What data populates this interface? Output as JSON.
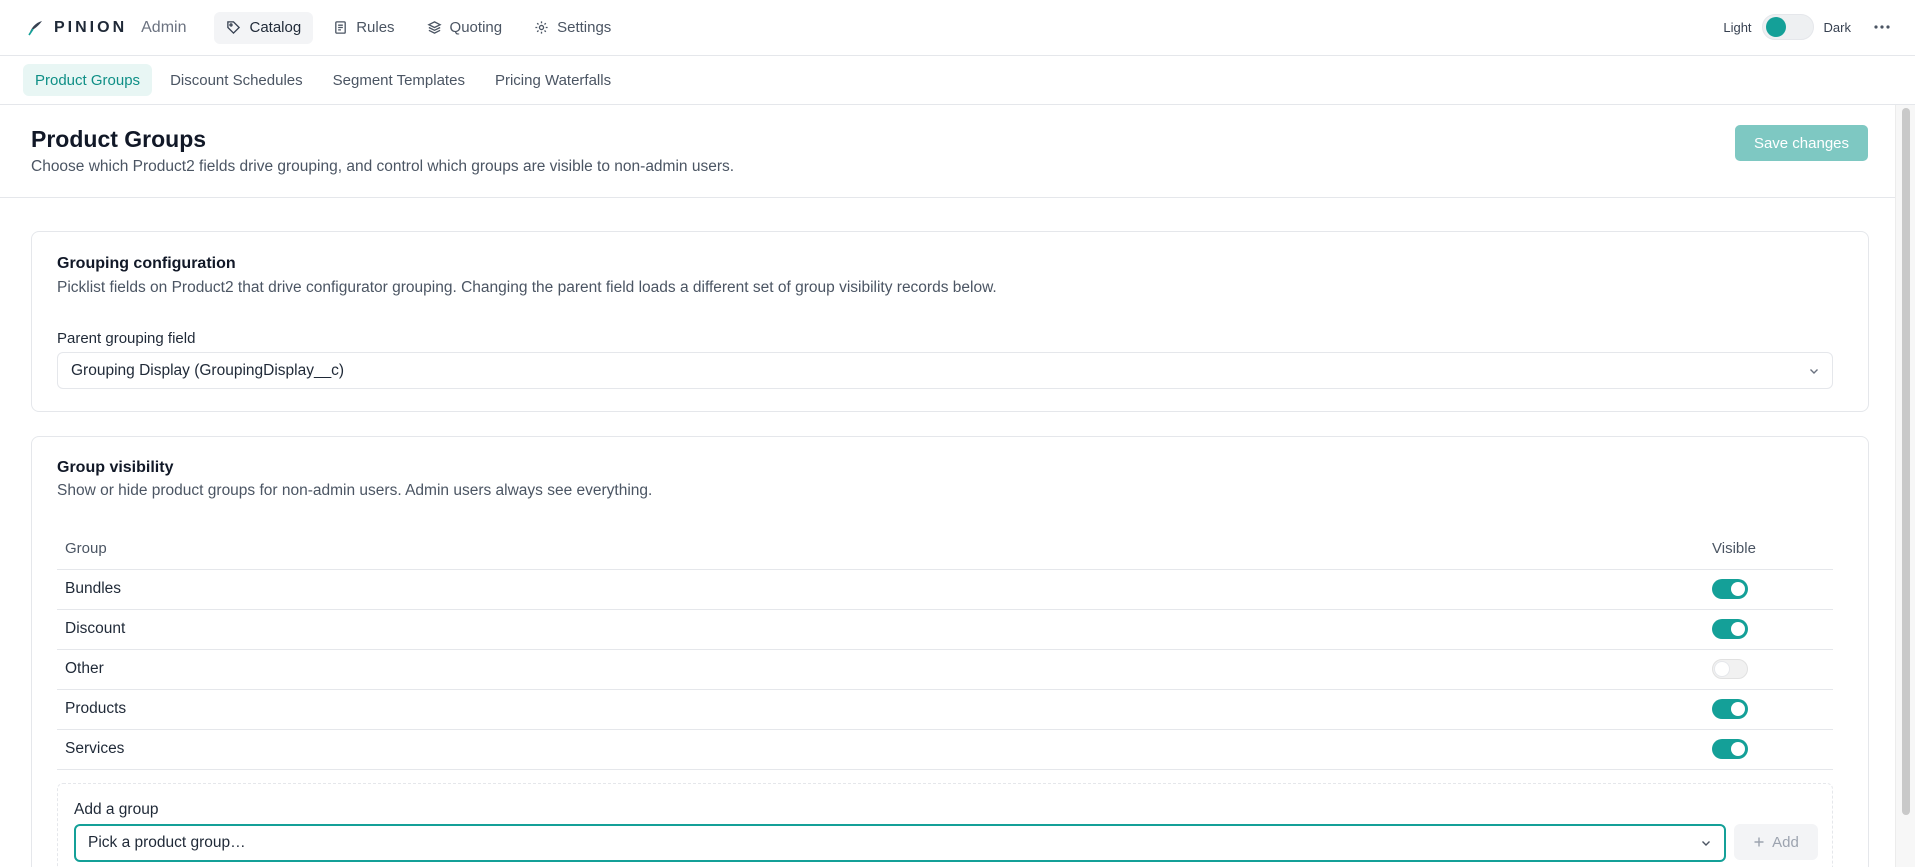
{
  "app": {
    "brand": "PINION",
    "brand_sub": "Admin",
    "accent_color": "#14a098"
  },
  "topnav": {
    "items": [
      {
        "label": "Catalog",
        "icon": "tag-icon",
        "active": true
      },
      {
        "label": "Rules",
        "icon": "document-icon",
        "active": false
      },
      {
        "label": "Quoting",
        "icon": "layers-icon",
        "active": false
      },
      {
        "label": "Settings",
        "icon": "gear-icon",
        "active": false
      }
    ]
  },
  "theme": {
    "light_label": "Light",
    "dark_label": "Dark",
    "mode": "light"
  },
  "subtabs": {
    "items": [
      {
        "label": "Product Groups",
        "active": true
      },
      {
        "label": "Discount Schedules",
        "active": false
      },
      {
        "label": "Segment Templates",
        "active": false
      },
      {
        "label": "Pricing Waterfalls",
        "active": false
      }
    ]
  },
  "header": {
    "title": "Product Groups",
    "subtitle": "Choose which Product2 fields drive grouping, and control which groups are visible to non-admin users.",
    "save_label": "Save changes"
  },
  "grouping": {
    "title": "Grouping configuration",
    "description": "Picklist fields on Product2 that drive configurator grouping. Changing the parent field loads a different set of group visibility records below.",
    "field_label": "Parent grouping field",
    "selected_value": "Grouping Display (GroupingDisplay__c)"
  },
  "visibility": {
    "title": "Group visibility",
    "description": "Show or hide product groups for non-admin users. Admin users always see everything.",
    "col_group": "Group",
    "col_visible": "Visible",
    "rows": [
      {
        "name": "Bundles",
        "visible": true
      },
      {
        "name": "Discount",
        "visible": true
      },
      {
        "name": "Other",
        "visible": false
      },
      {
        "name": "Products",
        "visible": true
      },
      {
        "name": "Services",
        "visible": true
      }
    ]
  },
  "add_group": {
    "label": "Add a group",
    "placeholder": "Pick a product group…",
    "button_label": "Add"
  }
}
